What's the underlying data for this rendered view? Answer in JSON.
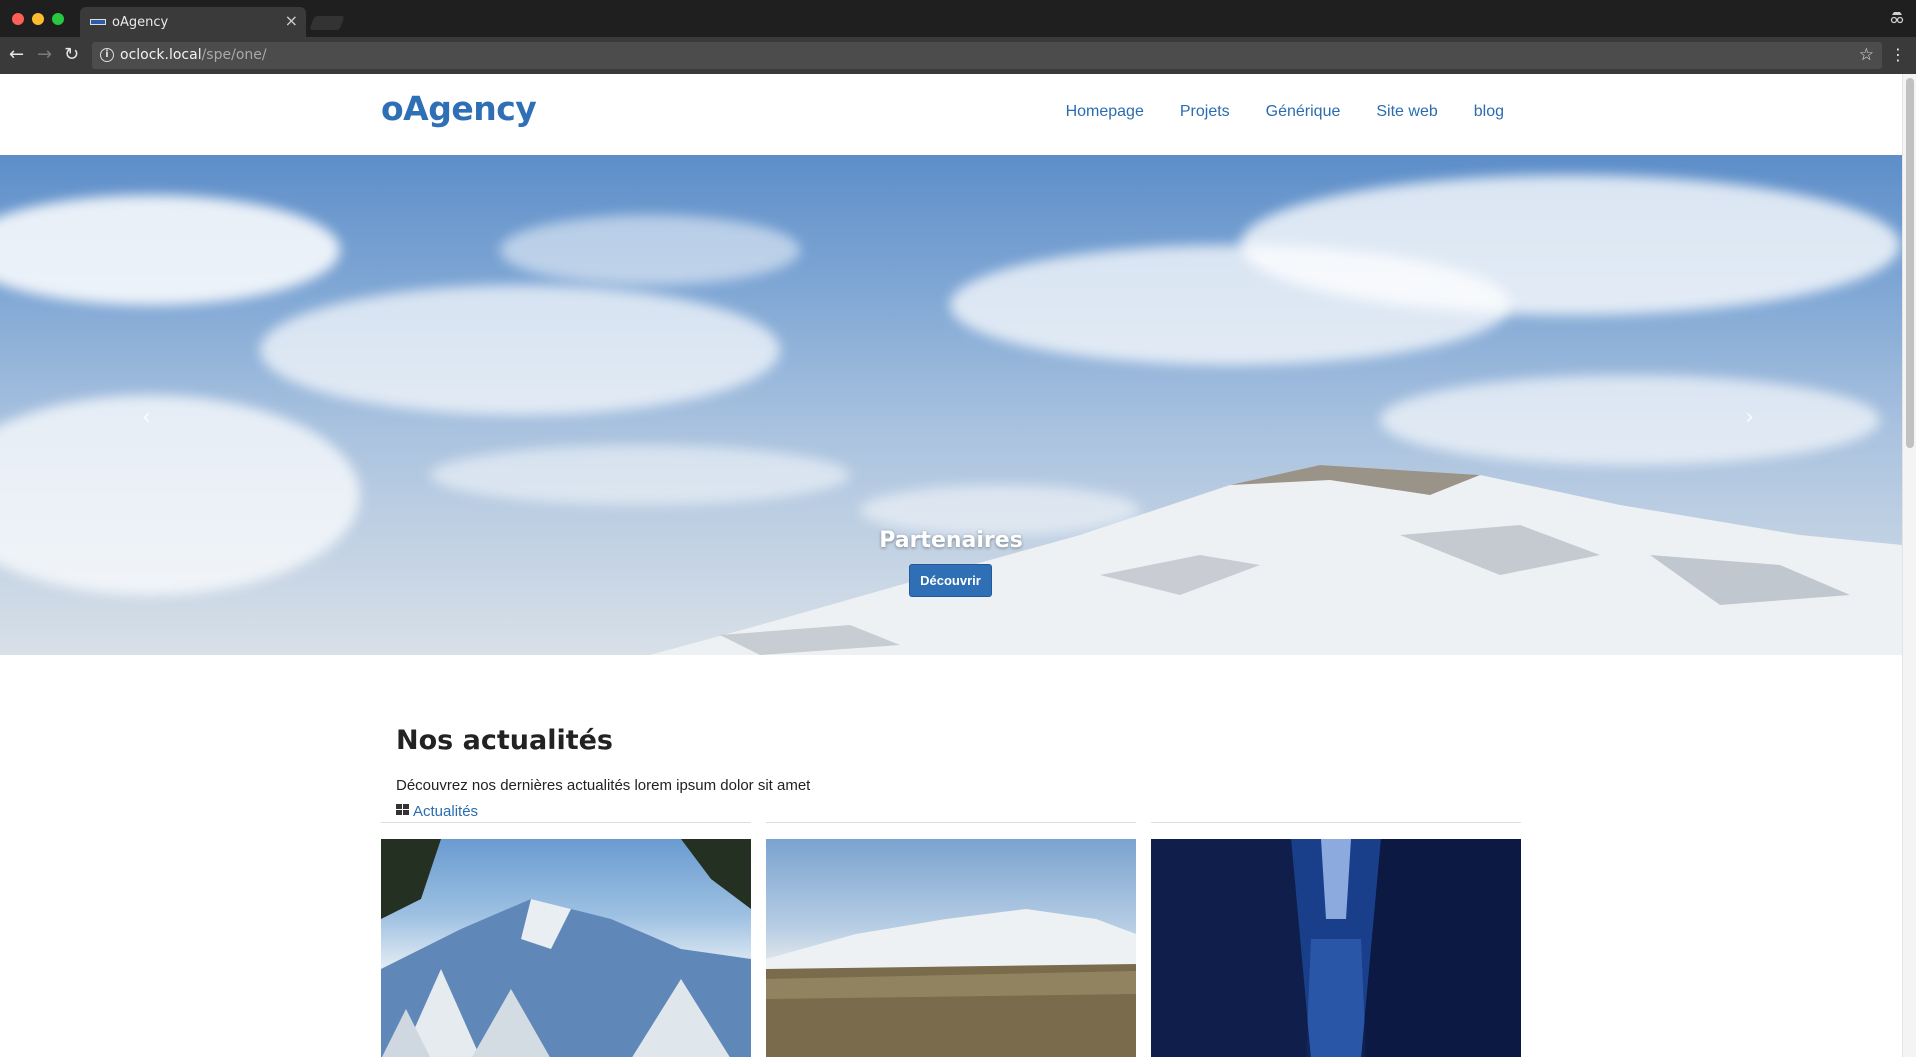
{
  "browser": {
    "tab_title": "oAgency",
    "url_host": "oclock.local",
    "url_path": "/spe/one/"
  },
  "header": {
    "logo": "oAgency",
    "nav": [
      "Homepage",
      "Projets",
      "Générique",
      "Site web",
      "blog"
    ]
  },
  "hero": {
    "title": "Partenaires",
    "button_label": "Découvrir",
    "prev_arrow": "‹",
    "next_arrow": "›"
  },
  "news": {
    "title": "Nos actualités",
    "description": "Découvrez nos dernières actualités lorem ipsum dolor sit amet",
    "tab_label": "Actualités"
  },
  "colors": {
    "brand": "#2f6fb6",
    "link": "#2b6cb0"
  }
}
